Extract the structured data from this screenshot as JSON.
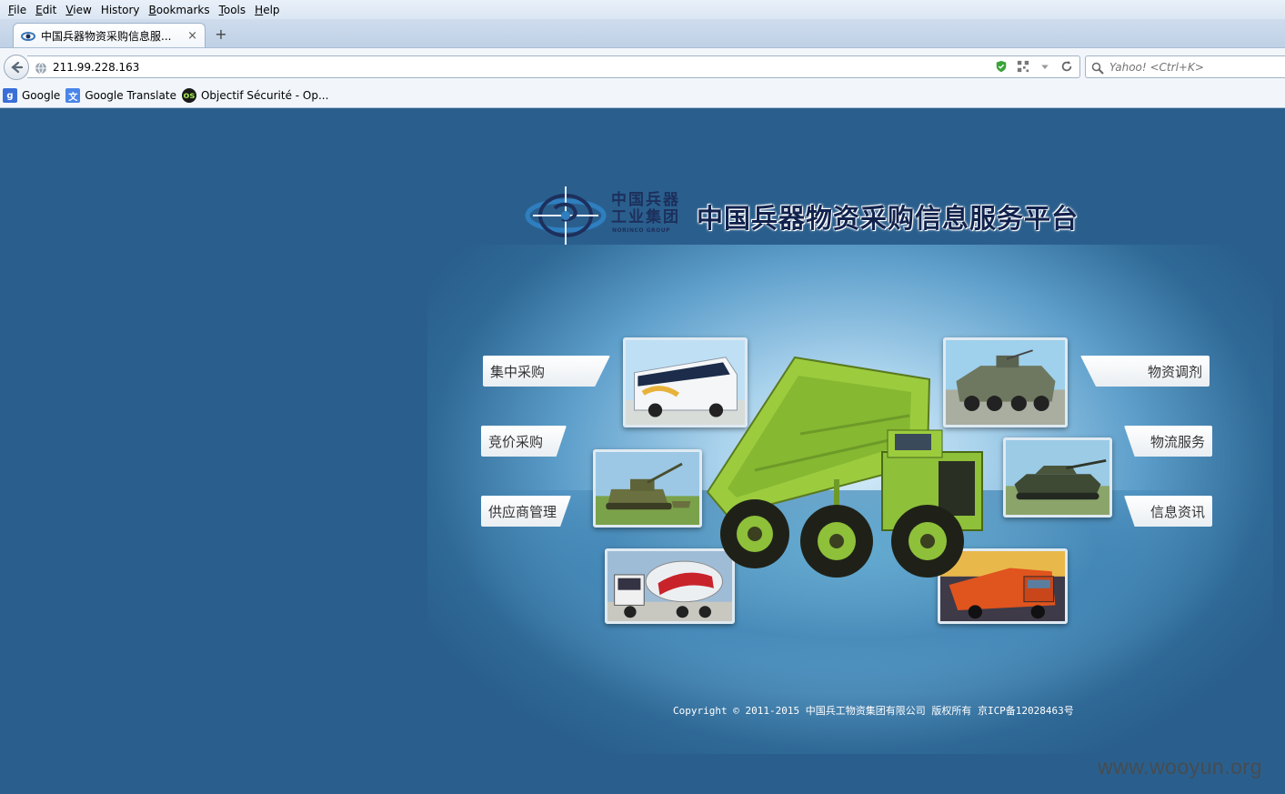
{
  "menu": {
    "items": [
      {
        "label": "File",
        "accel": "F",
        "rest": "ile"
      },
      {
        "label": "Edit",
        "accel": "E",
        "rest": "dit"
      },
      {
        "label": "View",
        "accel": "V",
        "rest": "iew"
      },
      {
        "label": "History",
        "accel": "",
        "rest": "History"
      },
      {
        "label": "Bookmarks",
        "accel": "B",
        "rest": "ookmarks"
      },
      {
        "label": "Tools",
        "accel": "T",
        "rest": "ools"
      },
      {
        "label": "Help",
        "accel": "H",
        "rest": "elp"
      }
    ]
  },
  "tab": {
    "title": "中国兵器物资采购信息服...",
    "close_glyph": "×",
    "new_tab_glyph": "+"
  },
  "address": {
    "url": "211.99.228.163"
  },
  "search": {
    "placeholder": "Yahoo! <Ctrl+K>"
  },
  "bookmarks": [
    {
      "label": "Google",
      "icon": "google-icon",
      "color": "#3b6fd8"
    },
    {
      "label": "Google Translate",
      "icon": "translate-icon",
      "color": "#4a86e8"
    },
    {
      "label": "Objectif Sécurité - Op...",
      "icon": "os-icon",
      "color": "#1a1a1a"
    }
  ],
  "site": {
    "logo_cn_line1": "中国兵器",
    "logo_cn_line2": "工业集团",
    "logo_en": "NORINCO GROUP",
    "title": "中国兵器物资采购信息服务平台"
  },
  "nav": {
    "left": [
      {
        "label": "集中采购"
      },
      {
        "label": "竞价采购"
      },
      {
        "label": "供应商管理"
      }
    ],
    "right": [
      {
        "label": "物资调剂"
      },
      {
        "label": "物流服务"
      },
      {
        "label": "信息资讯"
      }
    ]
  },
  "footer": {
    "copyright": "Copyright © 2011-2015 中国兵工物资集团有限公司 版权所有 京ICP备12028463号"
  },
  "watermark": "www.wooyun.org",
  "colors": {
    "page_bg": "#2a5f8d",
    "title_text": "#11224d",
    "truck_green": "#8fc43a"
  }
}
